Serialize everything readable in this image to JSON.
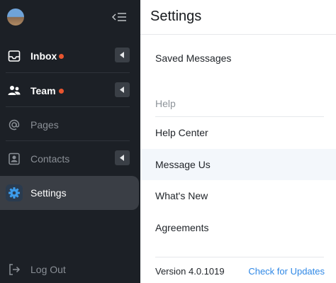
{
  "sidebar": {
    "items": [
      {
        "label": "Inbox",
        "icon": "inbox-icon",
        "badge": true,
        "expandable": true
      },
      {
        "label": "Team",
        "icon": "team-icon",
        "badge": true,
        "expandable": true
      },
      {
        "label": "Pages",
        "icon": "at-sign-icon",
        "badge": false,
        "expandable": false
      },
      {
        "label": "Contacts",
        "icon": "contacts-icon",
        "badge": false,
        "expandable": true
      },
      {
        "label": "Settings",
        "icon": "gear-icon",
        "badge": false,
        "expandable": false,
        "active": true
      }
    ],
    "logout_label": "Log Out"
  },
  "main": {
    "title": "Settings",
    "saved_messages": "Saved Messages",
    "help_section": "Help",
    "help_items": [
      "Help Center",
      "Message Us",
      "What's New",
      "Agreements"
    ],
    "highlighted_item": "Message Us",
    "version": "Version 4.0.1019",
    "check_updates": "Check for Updates"
  },
  "colors": {
    "sidebar_bg": "#1c2026",
    "badge_dot": "#e8552f",
    "link": "#2f88e6",
    "active_item_bg": "#3a3e45",
    "settings_icon": "#3d9be9"
  }
}
